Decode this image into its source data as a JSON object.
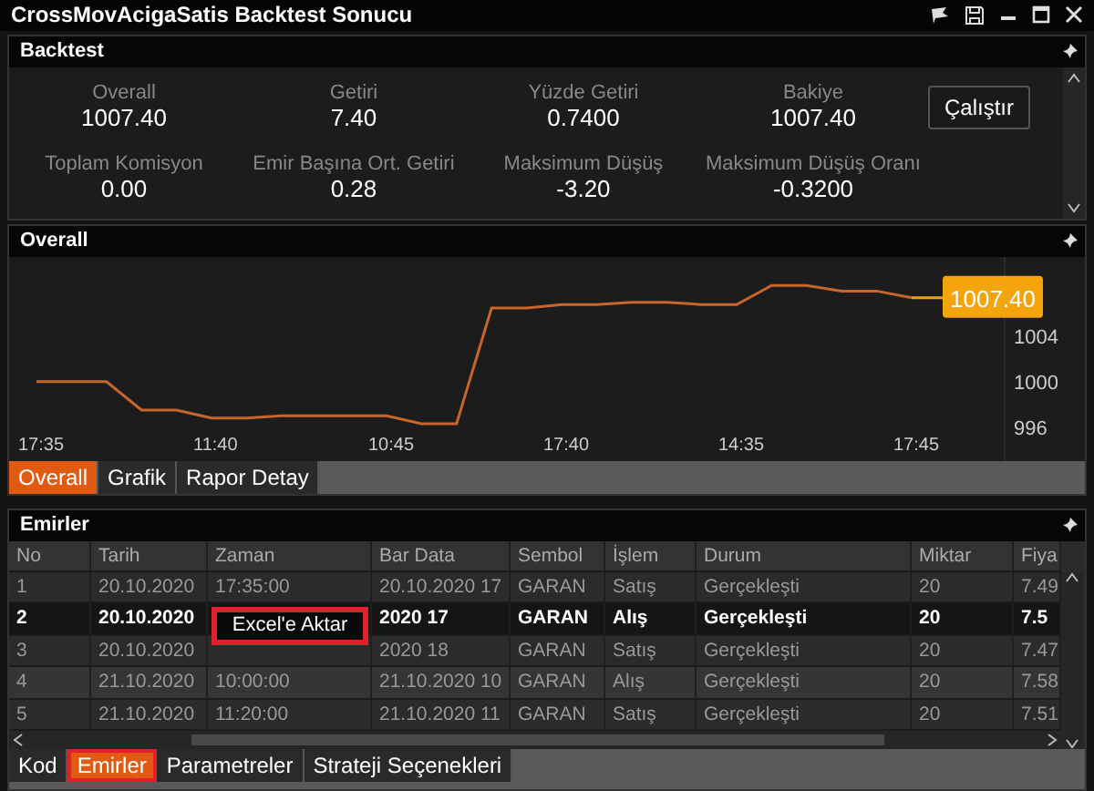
{
  "window": {
    "title": "CrossMovAcigaSatis Backtest Sonucu"
  },
  "backtest": {
    "title": "Backtest",
    "run_button": "Çalıştır",
    "stats": [
      {
        "label": "Overall",
        "value": "1007.40"
      },
      {
        "label": "Getiri",
        "value": "7.40"
      },
      {
        "label": "Yüzde Getiri",
        "value": "0.7400"
      },
      {
        "label": "Bakiye",
        "value": "1007.40"
      },
      {
        "label": "Toplam Komisyon",
        "value": "0.00"
      },
      {
        "label": "Emir Başına Ort. Getiri",
        "value": "0.28"
      },
      {
        "label": "Maksimum Düşüş",
        "value": "-3.20"
      },
      {
        "label": "Maksimum Düşüş Oranı",
        "value": "-0.3200"
      }
    ]
  },
  "overall": {
    "title": "Overall",
    "chart_data": {
      "type": "line",
      "categories": [
        "17:35",
        null,
        null,
        null,
        null,
        "11:40",
        null,
        null,
        null,
        null,
        "10:45",
        null,
        null,
        null,
        null,
        "17:40",
        null,
        null,
        null,
        null,
        "14:35",
        null,
        null,
        null,
        null,
        "17:45"
      ],
      "values": [
        1000,
        1000,
        1000,
        997.5,
        997.5,
        996.8,
        996.8,
        997,
        997,
        997,
        997,
        996.3,
        996.3,
        1006.5,
        1006.5,
        1006.8,
        1006.8,
        1007,
        1007,
        1006.8,
        1006.8,
        1008.5,
        1008.5,
        1008,
        1008,
        1007.4
      ],
      "ylim": [
        993,
        1011
      ],
      "yticks": [
        996,
        1000,
        1004
      ],
      "annotations": [
        "1007.40"
      ]
    },
    "tabs": [
      {
        "label": "Overall",
        "selected": true
      },
      {
        "label": "Grafik",
        "selected": false
      },
      {
        "label": "Rapor Detay",
        "selected": false
      }
    ]
  },
  "orders": {
    "title": "Emirler",
    "columns": [
      "No",
      "Tarih",
      "Zaman",
      "Bar Data",
      "Sembol",
      "İşlem",
      "Durum",
      "Miktar",
      "Fiya"
    ],
    "rows": [
      {
        "cells": [
          "1",
          "20.10.2020",
          "17:35:00",
          "20.10.2020 17",
          "GARAN",
          "Satış",
          "Gerçekleşti",
          "20",
          "7.49"
        ],
        "selected": false
      },
      {
        "cells": [
          "2",
          "20.10.2020",
          null,
          "2020 17",
          "GARAN",
          "Alış",
          "Gerçekleşti",
          "20",
          "7.5"
        ],
        "selected": true
      },
      {
        "cells": [
          "3",
          "20.10.2020",
          null,
          "2020 18",
          "GARAN",
          "Satış",
          "Gerçekleşti",
          "20",
          "7.47"
        ],
        "selected": false
      },
      {
        "cells": [
          "4",
          "21.10.2020",
          "10:00:00",
          "21.10.2020 10",
          "GARAN",
          "Alış",
          "Gerçekleşti",
          "20",
          "7.58"
        ],
        "selected": false
      },
      {
        "cells": [
          "5",
          "21.10.2020",
          "11:20:00",
          "21.10.2020 11",
          "GARAN",
          "Satış",
          "Gerçekleşti",
          "20",
          "7.51"
        ],
        "selected": false
      }
    ],
    "context_menu": {
      "label": "Excel'e Aktar",
      "highlighted": true
    }
  },
  "bottom_tabs": [
    {
      "label": "Kod",
      "selected": false,
      "highlighted": false
    },
    {
      "label": "Emirler",
      "selected": true,
      "highlighted": true
    },
    {
      "label": "Parametreler",
      "selected": false,
      "highlighted": false
    },
    {
      "label": "Strateji Seçenekleri",
      "selected": false,
      "highlighted": false
    }
  ]
}
